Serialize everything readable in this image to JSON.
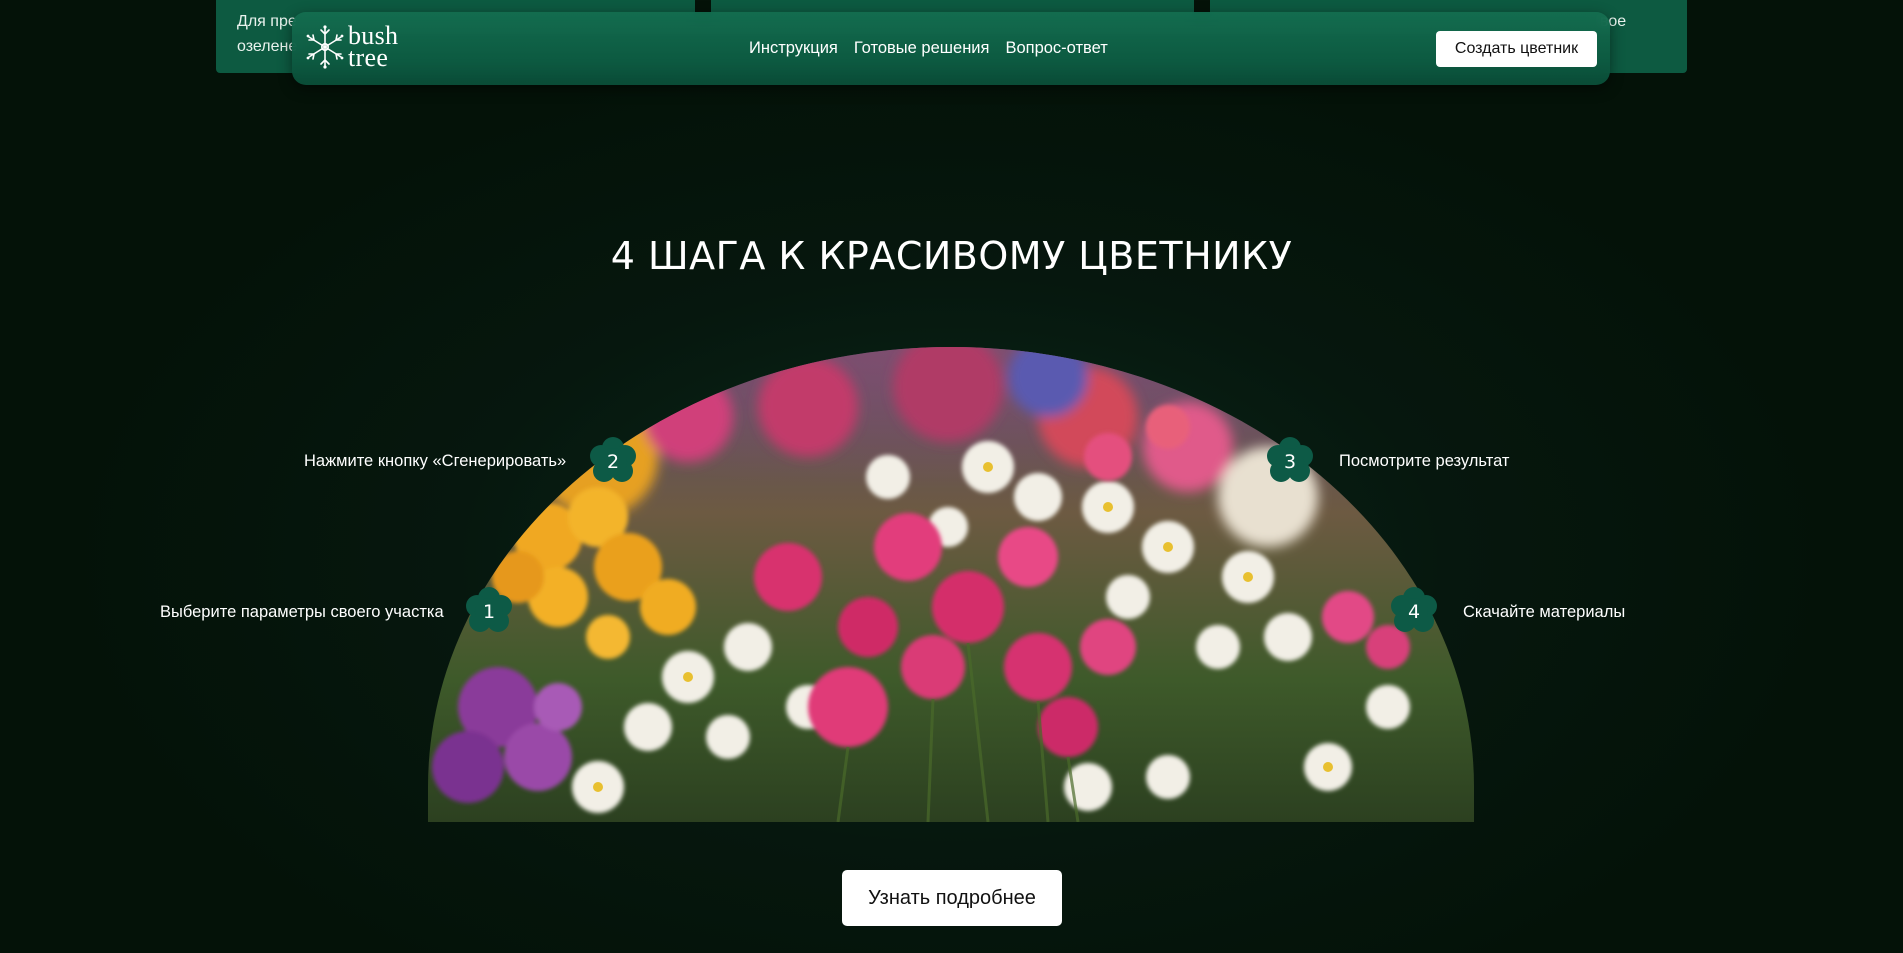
{
  "background_cards": {
    "left_fragment": "Для пре\nозелене",
    "right_fragment": "вое"
  },
  "navbar": {
    "logo": {
      "word_line1": "bush",
      "word_line2": "tree",
      "icon": "snowflake-leaf-icon"
    },
    "links": [
      {
        "label": "Инструкция"
      },
      {
        "label": "Готовые решения"
      },
      {
        "label": "Вопрос-ответ"
      }
    ],
    "cta_label": "Создать цветник"
  },
  "steps_section": {
    "title": "4 ШАГА К КРАСИВОМУ ЦВЕТНИКУ",
    "steps": [
      {
        "number": "1",
        "label": "Выберите параметры своего участка"
      },
      {
        "number": "2",
        "label": "Нажмите кнопку «Сгенерировать»"
      },
      {
        "number": "3",
        "label": "Посмотрите результат"
      },
      {
        "number": "4",
        "label": "Скачайте материалы"
      }
    ],
    "more_button_label": "Узнать подробнее"
  },
  "colors": {
    "page_background": "#041208",
    "navbar": "#0f6a4c",
    "badge": "#0d5a46",
    "button_bg": "#ffffff"
  }
}
